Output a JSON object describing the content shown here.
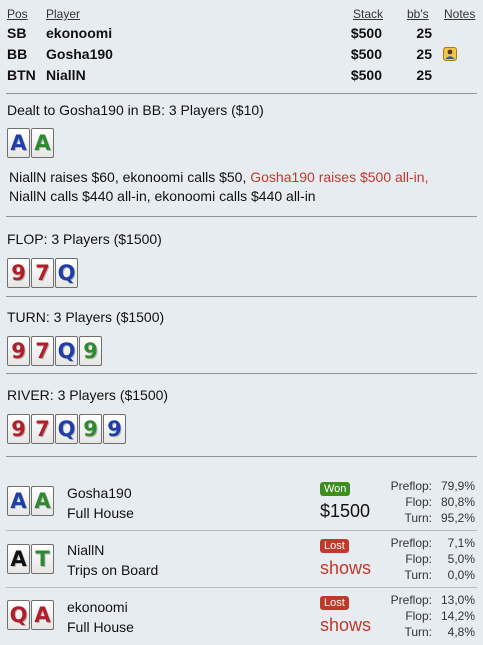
{
  "header": {
    "pos": "Pos",
    "player": "Player",
    "stack": "Stack",
    "bbs": "bb's",
    "notes": "Notes"
  },
  "players": [
    {
      "pos": "SB",
      "name": "ekonoomi",
      "stack": "$500",
      "bbs": "25",
      "note": false
    },
    {
      "pos": "BB",
      "name": "Gosha190",
      "stack": "$500",
      "bbs": "25",
      "note": true
    },
    {
      "pos": "BTN",
      "name": "NiallN",
      "stack": "$500",
      "bbs": "25",
      "note": false
    }
  ],
  "preflop": {
    "title": "Dealt to Gosha190 in BB: 3 Players ($10)",
    "cards": [
      {
        "rank": "A",
        "color": "#1f3fa6"
      },
      {
        "rank": "A",
        "color": "#2f8a2f"
      }
    ],
    "actions_1": "NiallN raises $60, ekonoomi calls $50, ",
    "actions_hl": "Gosha190 raises $500 all-in,",
    "actions_2": "NiallN calls $440 all-in, ekonoomi calls $440 all-in"
  },
  "flop": {
    "title": "FLOP: 3 Players ($1500)",
    "cards": [
      {
        "rank": "9",
        "color": "#b0202a"
      },
      {
        "rank": "7",
        "color": "#b0202a"
      },
      {
        "rank": "Q",
        "color": "#1f3fa6"
      }
    ]
  },
  "turn": {
    "title": "TURN: 3 Players ($1500)",
    "cards": [
      {
        "rank": "9",
        "color": "#b0202a"
      },
      {
        "rank": "7",
        "color": "#b0202a"
      },
      {
        "rank": "Q",
        "color": "#1f3fa6"
      },
      {
        "rank": "9",
        "color": "#2f8a2f"
      }
    ]
  },
  "river": {
    "title": "RIVER: 3 Players ($1500)",
    "cards": [
      {
        "rank": "9",
        "color": "#b0202a"
      },
      {
        "rank": "7",
        "color": "#b0202a"
      },
      {
        "rank": "Q",
        "color": "#1f3fa6"
      },
      {
        "rank": "9",
        "color": "#2f8a2f"
      },
      {
        "rank": "9",
        "color": "#1f3fa6"
      }
    ]
  },
  "results": [
    {
      "name": "Gosha190",
      "hand": "Full House",
      "status": "Won",
      "result": "$1500",
      "cards": [
        {
          "rank": "A",
          "color": "#1f3fa6"
        },
        {
          "rank": "A",
          "color": "#2f8a2f"
        }
      ],
      "preflop_label": "Preflop:",
      "preflop": "79,9%",
      "flop_label": "Flop:",
      "flop": "80,8%",
      "turn_label": "Turn:",
      "turn": "95,2%"
    },
    {
      "name": "NiallN",
      "hand": "Trips on Board",
      "status": "Lost",
      "result": "shows",
      "cards": [
        {
          "rank": "A",
          "color": "#111111"
        },
        {
          "rank": "T",
          "color": "#2f8a2f"
        }
      ],
      "preflop_label": "Preflop:",
      "preflop": "7,1%",
      "flop_label": "Flop:",
      "flop": "5,0%",
      "turn_label": "Turn:",
      "turn": "0,0%"
    },
    {
      "name": "ekonoomi",
      "hand": "Full House",
      "status": "Lost",
      "result": "shows",
      "cards": [
        {
          "rank": "Q",
          "color": "#b0202a"
        },
        {
          "rank": "A",
          "color": "#b0202a"
        }
      ],
      "preflop_label": "Preflop:",
      "preflop": "13,0%",
      "flop_label": "Flop:",
      "flop": "14,2%",
      "turn_label": "Turn:",
      "turn": "4,8%"
    }
  ]
}
